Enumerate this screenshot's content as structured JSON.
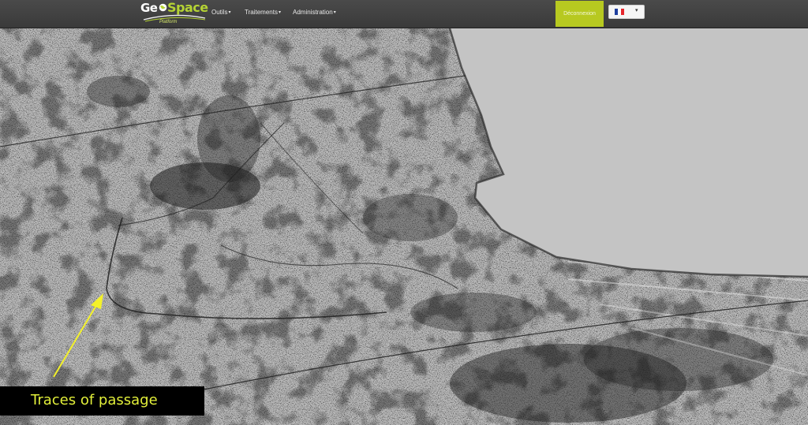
{
  "header": {
    "logo": {
      "geo": "Ge",
      "space": "Space",
      "tagline": "Platform",
      "icon": "globe-icon"
    },
    "menus": [
      {
        "label": "Outils",
        "icon": "caret-down-icon"
      },
      {
        "label": "Traitements",
        "icon": "caret-down-icon"
      },
      {
        "label": "Administration",
        "icon": "caret-down-icon"
      }
    ],
    "logout_label": "Déconnexion",
    "language": {
      "selected": "FR",
      "icon": "flag-france-icon",
      "caret_icon": "caret-down-icon"
    }
  },
  "map": {
    "caption": "Traces of passage",
    "annotation_arrow_color": "#f4f229",
    "sea_color": "#c4c4c4"
  },
  "colors": {
    "navbar": "#3f3f3f",
    "accent_green": "#b7c920",
    "logo_green": "#b5d334",
    "caption_text": "#e2ef3a",
    "flag_blue": "#1f3f9e",
    "flag_white": "#ffffff",
    "flag_red": "#e5262c"
  }
}
